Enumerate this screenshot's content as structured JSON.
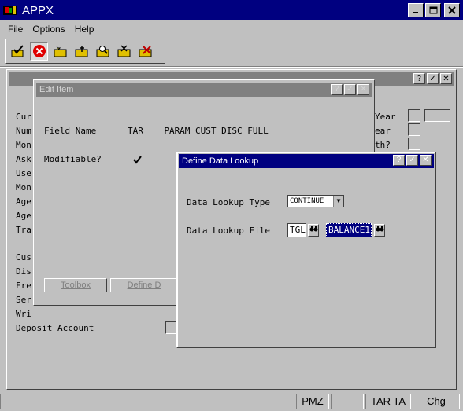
{
  "app": {
    "title": "APPX"
  },
  "menu": [
    "File",
    "Options",
    "Help"
  ],
  "bg_left_labels": [
    "Cur",
    "Num",
    "Mon",
    "Ask",
    "Use",
    "Mon",
    "Age",
    "Age",
    "Tra",
    "Cus",
    "Dis",
    "Fre",
    "Ser",
    "Wri"
  ],
  "bg_deposit_label": "Deposit Account",
  "bg_right_labels": [
    "Year",
    "ear",
    "th?"
  ],
  "edit_item": {
    "title": "Edit Item",
    "header": "Field Name      TAR    PARAM CUST DISC FULL",
    "modifiable_label": "Modifiable?",
    "toolbox_label": "Toolbox",
    "define_label": "Define D"
  },
  "data_lookup": {
    "title": "Define Data Lookup",
    "type_label": "Data Lookup Type",
    "type_value": "CONTINUE",
    "file_label": "Data Lookup File",
    "file_app": "TGL",
    "file_name": "BALANCE1"
  },
  "status": {
    "cell1": "PMZ",
    "cell2": "TAR TA",
    "cell3": "Chg"
  }
}
